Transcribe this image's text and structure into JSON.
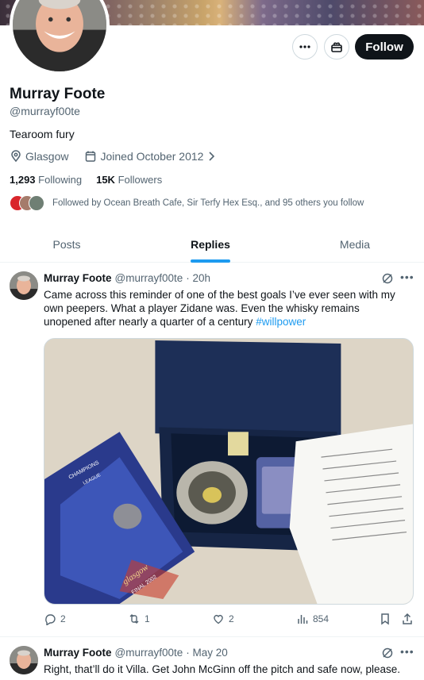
{
  "profile": {
    "name": "Murray Foote",
    "handle": "@murrayf00te",
    "bio": "Tearoom fury",
    "location": "Glasgow",
    "joined": "Joined October 2012",
    "following_count": "1,293",
    "following_label": "Following",
    "followers_count": "15K",
    "followers_label": "Followers",
    "followed_by": "Followed by Ocean Breath Cafe, Sir Terfy Hex Esq., and 95 others you follow"
  },
  "header": {
    "follow_label": "Follow",
    "more_icon": "more-horizontal-icon",
    "subscribe_icon": "gift-icon"
  },
  "tabs": [
    {
      "label": "Posts"
    },
    {
      "label": "Replies"
    },
    {
      "label": "Media"
    }
  ],
  "tweets": [
    {
      "name": "Murray Foote",
      "handle": "@murrayf00te",
      "time": "· 20h",
      "text": "Came across this reminder of one of the best goals I’ve ever seen with my own peepers. What a player Zidane was. Even the whisky remains unopened after nearly a quarter of a century ",
      "hashtag": "#willpower",
      "media_text": {
        "brand": "CHAMPIONS",
        "league": "LEAGUE",
        "city": "glasgow",
        "final": "FINAL 2002"
      },
      "replies": "2",
      "retweets": "1",
      "likes": "2",
      "views": "854"
    },
    {
      "name": "Murray Foote",
      "handle": "@murrayf00te",
      "time": "· May 20",
      "text": "Right, that’ll do it Villa. Get John McGinn off the pitch and safe now, please."
    }
  ],
  "colors": {
    "accent": "#1d9bf0",
    "text": "#0f1419",
    "muted": "#536471"
  }
}
